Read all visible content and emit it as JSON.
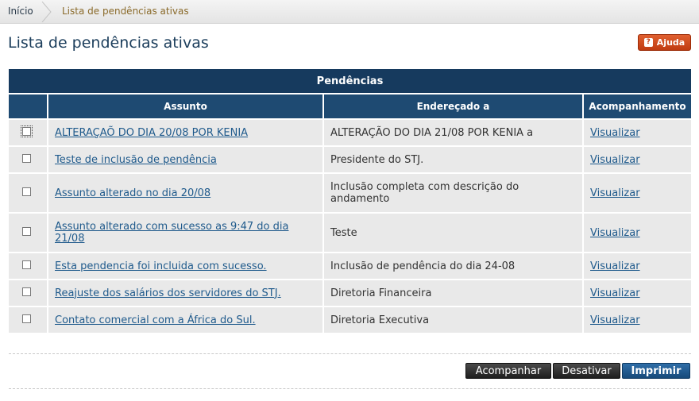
{
  "breadcrumb": {
    "home": "Início",
    "current": "Lista de pendências ativas"
  },
  "page": {
    "title": "Lista de pendências ativas",
    "help_label": "Ajuda",
    "help_icon": "?"
  },
  "table": {
    "caption": "Pendências",
    "columns": [
      "Assunto",
      "Endereçado a",
      "Acompanhamento"
    ],
    "rows": [
      {
        "subject": "ALTERAÇAÕ DO DIA 20/08 POR KENIA",
        "addressee": "ALTERAÇÃO DO DIA 21/08 POR KENIA a",
        "action": "Visualizar"
      },
      {
        "subject": "Teste de inclusão de pendência",
        "addressee": "Presidente do STJ.",
        "action": "Visualizar"
      },
      {
        "subject": "Assunto alterado no dia 20/08",
        "addressee": "Inclusão completa com descrição do andamento",
        "action": "Visualizar"
      },
      {
        "subject": "Assunto alterado com sucesso as 9:47 do dia 21/08",
        "addressee": "Teste",
        "action": "Visualizar"
      },
      {
        "subject": "Esta pendencia foi incluida com sucesso.",
        "addressee": "Inclusão de pendência do dia 24-08",
        "action": "Visualizar"
      },
      {
        "subject": "Reajuste dos salários dos servidores do STJ.",
        "addressee": "Diretoria Financeira",
        "action": "Visualizar"
      },
      {
        "subject": "Contato comercial com a África do Sul.",
        "addressee": "Diretoria Executiva",
        "action": "Visualizar"
      }
    ]
  },
  "buttons": {
    "follow": "Acompanhar",
    "deactivate": "Desativar",
    "print": "Imprimir"
  },
  "colors": {
    "header": "#163a5e",
    "subheader": "#1e4a72",
    "row": "#e9e9e9",
    "link": "#1f5a8c",
    "help": "#c8421a"
  }
}
